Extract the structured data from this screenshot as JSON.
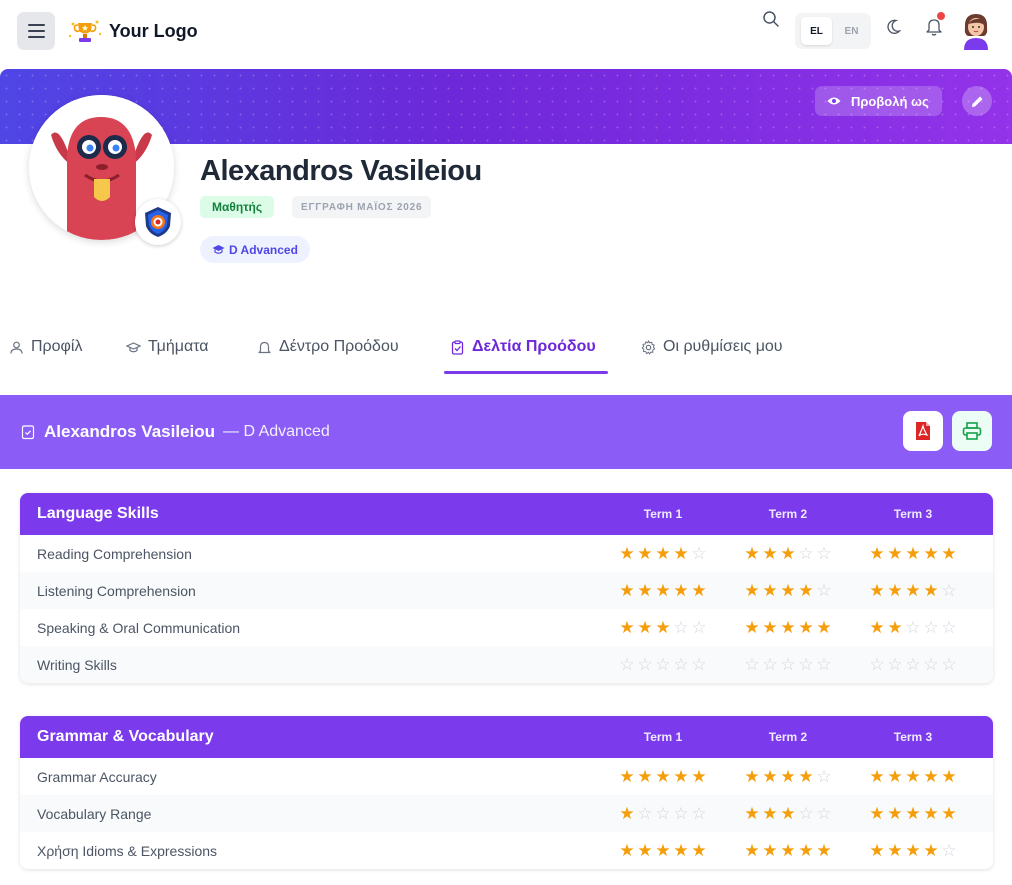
{
  "header": {
    "logo_text": "Your Logo",
    "lang_el": "EL",
    "lang_en": "EN"
  },
  "profile": {
    "view_as_label": "Προβολή ως",
    "name": "Alexandros Vasileiou",
    "role": "Μαθητής",
    "enrollment": "ΕΓΓΡΑΦΗ ΜΑΪΟΣ 2026",
    "level": "D Advanced"
  },
  "tabs": [
    {
      "label": "Προφίλ",
      "icon": "user-icon"
    },
    {
      "label": "Τμήματα",
      "icon": "graduation-cap-icon"
    },
    {
      "label": "Δέντρο Προόδου",
      "icon": "bell-tree-icon"
    },
    {
      "label": "Δελτία Προόδου",
      "icon": "clipboard-check-icon"
    },
    {
      "label": "Οι ρυθμίσεις μου",
      "icon": "gear-icon"
    }
  ],
  "report": {
    "student": "Alexandros Vasileiou",
    "level_suffix": "— D Advanced"
  },
  "terms": [
    "Term 1",
    "Term 2",
    "Term 3"
  ],
  "sections": [
    {
      "title": "Language Skills",
      "rows": [
        {
          "label": "Reading Comprehension",
          "ratings": [
            4,
            3,
            5
          ]
        },
        {
          "label": "Listening Comprehension",
          "ratings": [
            5,
            4,
            4
          ]
        },
        {
          "label": "Speaking & Oral Communication",
          "ratings": [
            3,
            5,
            2
          ]
        },
        {
          "label": "Writing Skills",
          "ratings": [
            0,
            0,
            0
          ]
        }
      ]
    },
    {
      "title": "Grammar & Vocabulary",
      "rows": [
        {
          "label": "Grammar Accuracy",
          "ratings": [
            5,
            4,
            5
          ]
        },
        {
          "label": "Vocabulary Range",
          "ratings": [
            1,
            3,
            5
          ]
        },
        {
          "label": "Χρήση Idioms & Expressions",
          "ratings": [
            5,
            5,
            4
          ]
        }
      ]
    }
  ],
  "colors": {
    "accent": "#7c3aed",
    "star": "#f59e0b",
    "star_empty": "#d1d5db"
  }
}
